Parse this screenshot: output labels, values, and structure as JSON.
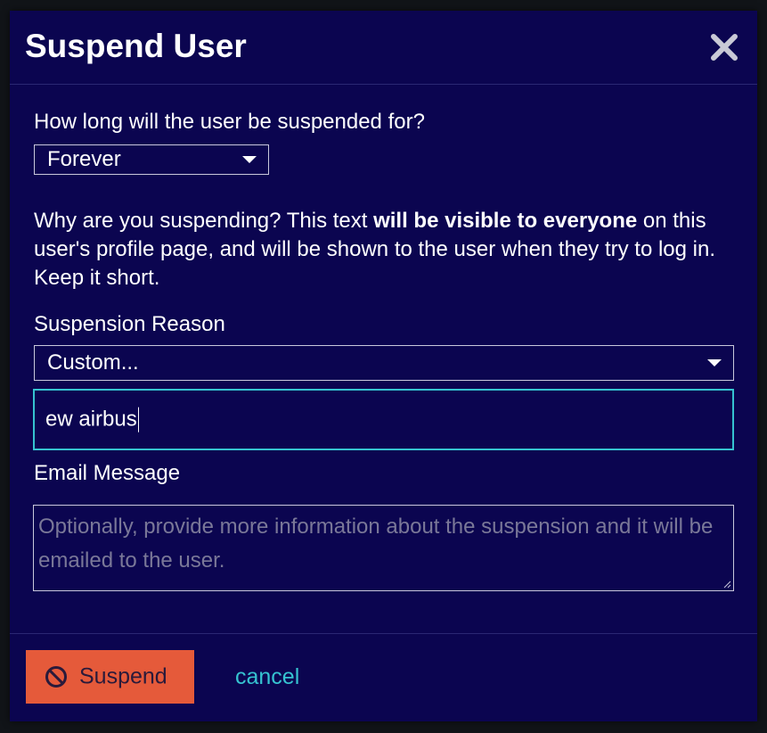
{
  "dialog": {
    "title": "Suspend User"
  },
  "duration": {
    "question": "How long will the user be suspended for?",
    "selected": "Forever"
  },
  "reason_help": {
    "text_before": "Why are you suspending? This text ",
    "text_bold": "will be visible to everyone",
    "text_after": " on this user's profile page, and will be shown to the user when they try to log in. Keep it short."
  },
  "suspension_reason": {
    "label": "Suspension Reason",
    "selected": "Custom...",
    "custom_value": "ew airbus"
  },
  "email_message": {
    "label": "Email Message",
    "placeholder": "Optionally, provide more information about the suspension and it will be emailed to the user."
  },
  "footer": {
    "suspend_label": "Suspend",
    "cancel_label": "cancel"
  },
  "colors": {
    "modal_bg": "#0b0550",
    "accent": "#36c3d1",
    "suspend_button": "#e55a3a"
  }
}
